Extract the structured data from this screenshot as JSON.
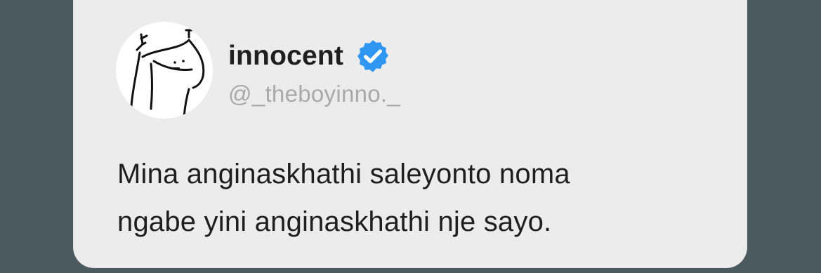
{
  "tweet": {
    "display_name": "innocent",
    "handle": "@_theboyinno._",
    "verified": true,
    "verified_icon": "verified-badge-icon",
    "text_lines": [
      "Mina anginaskhathi saleyonto noma",
      "ngabe yini anginaskhathi nje sayo."
    ]
  },
  "colors": {
    "page_background": "#4b5a5e",
    "card_background": "#ececec",
    "verified_blue": "#2f97f2",
    "name_text": "#1f1f1f",
    "handle_text": "#a9a9a9"
  }
}
